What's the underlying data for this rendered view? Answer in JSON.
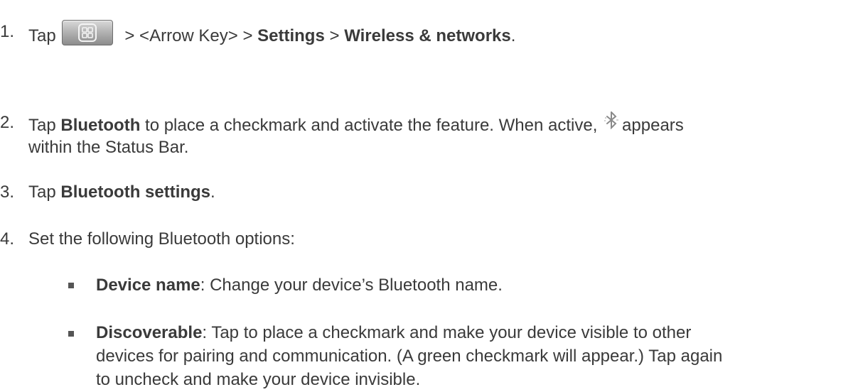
{
  "steps": [
    {
      "num": "1.",
      "pre": "Tap",
      "sep1": " > <Arrow Key> > ",
      "b1": "Settings",
      "sep2": " > ",
      "b2": "Wireless & networks",
      "end": "."
    },
    {
      "num": "2.",
      "pre": "Tap ",
      "b1": "Bluetooth",
      "post": " to place a checkmark and activate the feature. When active, ",
      "post2": "appears",
      "line2": "within the Status Bar."
    },
    {
      "num": "3.",
      "pre": "Tap ",
      "b1": "Bluetooth settings",
      "end": "."
    },
    {
      "num": "4.",
      "text": "Set the following Bluetooth options:"
    }
  ],
  "options": [
    {
      "bold": "Device name",
      "text": ": Change your device’s Bluetooth name."
    },
    {
      "bold": "Discoverable",
      "text1": ": Tap to place a checkmark and make your device visible to other",
      "text2": "devices for pairing and communication. (A green checkmark will appear.) Tap again",
      "text3": "to uncheck and make your device invisible."
    }
  ],
  "icons": [
    "home-key-icon",
    "bluetooth-icon"
  ]
}
